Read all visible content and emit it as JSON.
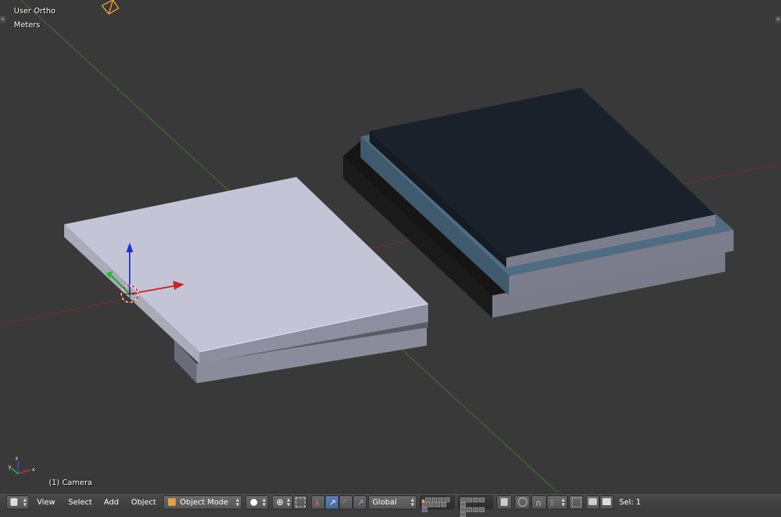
{
  "viewport": {
    "view_name": "User Ortho",
    "units": "Meters",
    "object_info": "(1) Camera",
    "plus_left": "+",
    "plus_right": "+"
  },
  "header": {
    "editor_type_icon": "3d-view-icon",
    "menus": {
      "view": "View",
      "select": "Select",
      "add": "Add",
      "object": "Object"
    },
    "mode": "Object Mode",
    "pivot": "Global",
    "selection_info": "Sel: 1"
  },
  "colors": {
    "background": "#393939",
    "x_axis": "#8a2a2a",
    "y_axis": "#3f7d2a",
    "highlight_object": "#c5c7d8",
    "dark_object": "#1b212b",
    "accent": "#5a7fb3"
  }
}
